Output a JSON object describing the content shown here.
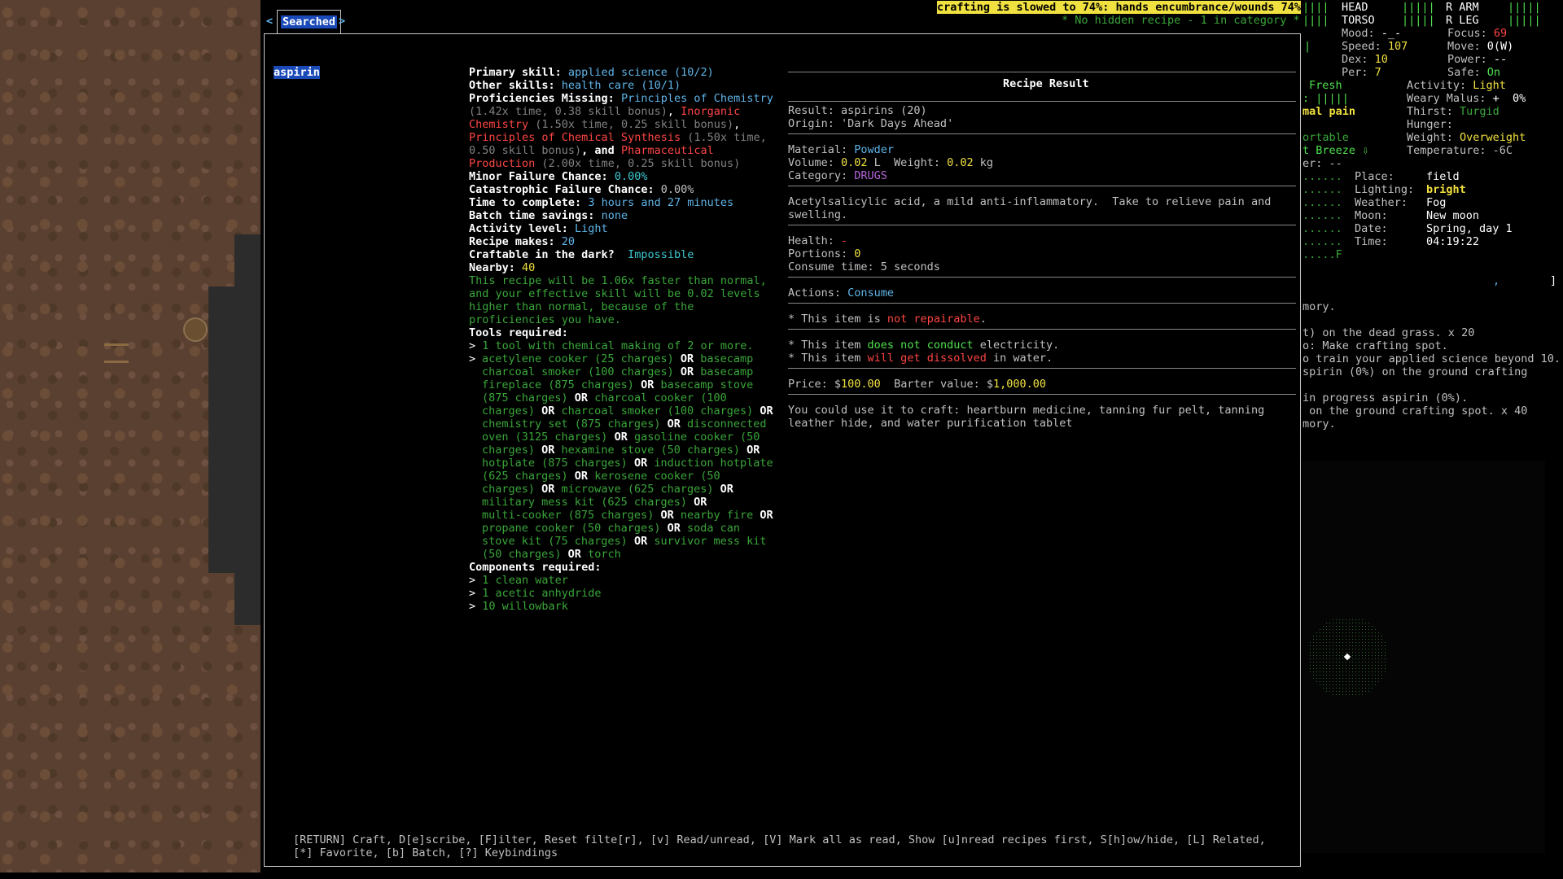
{
  "header": {
    "warning": "crafting is slowed to 74%: hands encumbrance/wounds 74%",
    "hidden_note": "* No hidden recipe - 1 in category *"
  },
  "tabs": {
    "prev_arrow": "<",
    "next_arrow": ">",
    "active_label": "Searched"
  },
  "recipe_list": {
    "selected": "aspirin"
  },
  "details": {
    "primary_skill_label": "Primary skill: ",
    "primary_skill_value": "applied science (10/2)",
    "other_skills_label": "Other skills: ",
    "other_skills_value": "health care (10/1)",
    "prof_missing_label": "Proficiencies Missing: ",
    "prof1": "Principles of Chemistry",
    "prof1_detail": "(1.42x time, 0.38 skill bonus)",
    "prof2a": "Inorganic",
    "prof2b": "Chemistry",
    "prof2_detail": "(1.50x time, 0.25 skill bonus)",
    "prof3": "Principles of Chemical Synthesis",
    "prof3_detail_a": "(1.50x time,",
    "prof3_detail_b": "0.50 skill bonus)",
    "and_text": ", and ",
    "prof4a": "Pharmaceutical",
    "prof4b": "Production",
    "prof4_detail": "(2.00x time, 0.25 skill bonus)",
    "minor_fail_label": "Minor Failure Chance: ",
    "minor_fail_value": "0.00%",
    "cat_fail_label": "Catastrophic Failure Chance: ",
    "cat_fail_value": "0.00%",
    "time_label": "Time to complete: ",
    "time_value": "3 hours and 27 minutes",
    "batch_label": "Batch time savings: ",
    "batch_value": "none",
    "activity_label": "Activity level: ",
    "activity_value": "Light",
    "makes_label": "Recipe makes: ",
    "makes_value": "20",
    "dark_label": "Craftable in the dark?  ",
    "dark_value": "Impossible",
    "nearby_label": "Nearby: ",
    "nearby_value": "40",
    "speed_note": [
      "This recipe will be 1.06x faster than normal,",
      "and your effective skill will be 0.02 levels",
      "higher than normal, because of the",
      "proficiencies you have."
    ],
    "tools_label": "Tools required:",
    "tool1": "1 tool with chemical making of 2 or more.",
    "tool_lines": [
      [
        [
          "acetylene cooker (25 charges)",
          "g"
        ],
        [
          " OR ",
          "w"
        ],
        [
          "basecamp",
          "g"
        ]
      ],
      [
        [
          "charcoal smoker (100 charges)",
          "g"
        ],
        [
          " OR ",
          "w"
        ],
        [
          "basecamp",
          "g"
        ]
      ],
      [
        [
          "fireplace (875 charges)",
          "g"
        ],
        [
          " OR ",
          "w"
        ],
        [
          "basecamp stove",
          "g"
        ]
      ],
      [
        [
          "(875 charges)",
          "g"
        ],
        [
          " OR ",
          "w"
        ],
        [
          "charcoal cooker (100",
          "g"
        ]
      ],
      [
        [
          "charges)",
          "g"
        ],
        [
          " OR ",
          "w"
        ],
        [
          "charcoal smoker (100 charges)",
          "g"
        ],
        [
          " OR",
          "w"
        ]
      ],
      [
        [
          "chemistry set (875 charges)",
          "g"
        ],
        [
          " OR ",
          "w"
        ],
        [
          "disconnected",
          "g"
        ]
      ],
      [
        [
          "oven (3125 charges)",
          "g"
        ],
        [
          " OR ",
          "w"
        ],
        [
          "gasoline cooker (50",
          "g"
        ]
      ],
      [
        [
          "charges)",
          "g"
        ],
        [
          " OR ",
          "w"
        ],
        [
          "hexamine stove (50 charges)",
          "g"
        ],
        [
          " OR",
          "w"
        ]
      ],
      [
        [
          "hotplate (875 charges)",
          "g"
        ],
        [
          " OR ",
          "w"
        ],
        [
          "induction hotplate",
          "g"
        ]
      ],
      [
        [
          "(625 charges)",
          "g"
        ],
        [
          " OR ",
          "w"
        ],
        [
          "kerosene cooker (50",
          "g"
        ]
      ],
      [
        [
          "charges)",
          "g"
        ],
        [
          " OR ",
          "w"
        ],
        [
          "microwave (625 charges)",
          "g"
        ],
        [
          " OR",
          "w"
        ]
      ],
      [
        [
          "military mess kit (625 charges)",
          "g"
        ],
        [
          " OR",
          "w"
        ]
      ],
      [
        [
          "multi-cooker (875 charges)",
          "g"
        ],
        [
          " OR ",
          "w"
        ],
        [
          "nearby fire",
          "g"
        ],
        [
          " OR",
          "w"
        ]
      ],
      [
        [
          "propane cooker (50 charges)",
          "g"
        ],
        [
          " OR ",
          "w"
        ],
        [
          "soda can",
          "g"
        ]
      ],
      [
        [
          "stove kit (75 charges)",
          "g"
        ],
        [
          " OR ",
          "w"
        ],
        [
          "survivor mess kit",
          "g"
        ]
      ],
      [
        [
          "(50 charges)",
          "g"
        ],
        [
          " OR ",
          "w"
        ],
        [
          "torch",
          "g"
        ]
      ]
    ],
    "components_label": "Components required:",
    "components": [
      "1 clean water",
      "1 acetic anhydride",
      "10 willowbark"
    ]
  },
  "result": {
    "title": "Recipe Result",
    "result_line": "Result: aspirins (20)",
    "origin_line": "Origin: 'Dark Days Ahead'",
    "material_label": "Material: ",
    "material_value": "Powder",
    "volume_label": "Volume: ",
    "volume_value": "0.02",
    "volume_unit": " L  Weight: ",
    "weight_value": "0.02",
    "weight_unit": " kg",
    "category_label": "Category: ",
    "category_value": "DRUGS",
    "description": [
      "Acetylsalicylic acid, a mild anti-inflammatory.  Take to relieve pain and",
      "swelling."
    ],
    "health_label": "Health: ",
    "health_value": "-",
    "portions_label": "Portions: ",
    "portions_value": "0",
    "consume_line": "Consume time: 5 seconds",
    "actions_label": "Actions: ",
    "actions_value": "Consume",
    "repair_pre": "* This item is ",
    "repair_val": "not repairable",
    "repair_post": ".",
    "elec_pre": "* This item ",
    "elec_val": "does not conduct",
    "elec_post": " electricity.",
    "water_pre": "* This item ",
    "water_val": "will get dissolved",
    "water_post": " in water.",
    "price_label": "Price: $",
    "price_value": "100.00",
    "barter_label": "  Barter value: $",
    "barter_value": "1,000.00",
    "craft_line1": "You could use it to craft: heartburn medicine, tanning fur pelt, tanning",
    "craft_line2": "leather hide, and water purification tablet"
  },
  "footer": {
    "line1": "[RETURN] Craft, D[e]scribe, [F]ilter, Reset filte[r], [v] Read/unread, [V] Mark all as read, Show [u]nread recipes first, S[h]ow/hide, [L] Related,",
    "line2": "[*] Favorite, [b] Batch, [?] Keybindings"
  },
  "sidebar": {
    "body": {
      "head": "HEAD",
      "head_bar": "|||||",
      "torso": "TORSO",
      "torso_bar": "|||||",
      "r_arm": "R ARM",
      "r_arm_bar": "|||||",
      "r_leg": "R LEG",
      "r_leg_bar": "|||||",
      "left_bar1": "||||",
      "left_bar2": "||||"
    },
    "stats": {
      "mood_label": "Mood: ",
      "mood_value": "-_-",
      "focus_label": "Focus: ",
      "focus_value": "69",
      "speed_label": "Speed: ",
      "speed_value": "107",
      "move_label": "Move: ",
      "move_value": "0(W)",
      "dex_label": "Dex: ",
      "dex_value": "10",
      "power_label": "Power: ",
      "power_value": "--",
      "per_label": "Per: ",
      "per_value": "7",
      "safe_label": "Safe: ",
      "safe_value": "On"
    },
    "needs": {
      "fresh": "Fresh",
      "activity_label": "Activity: ",
      "activity_value": "Light",
      "weary_label": "Weary Malus: ",
      "weary_value": "+  0%",
      "thirst_label": "Thirst: ",
      "thirst_value": "Turgid",
      "hunger_label": "Hunger: ",
      "weight_label": "Weight: ",
      "weight_value": "Overweight",
      "temp_label": "Temperature: ",
      "temp_value": "-6C",
      "bars": ": |||||",
      "pain": "mal pain",
      "comfort": "ortable",
      "wind": "t Breeze ⇩",
      "er": "er: --"
    },
    "env": {
      "place_label": "Place:",
      "place_value": "field",
      "light_label": "Lighting:",
      "light_value": "bright",
      "weather_label": "Weather:",
      "weather_value": "Fog",
      "moon_label": "Moon:",
      "moon_value": "New moon",
      "date_label": "Date:",
      "date_value": "Spring, day 1",
      "time_label": "Time:",
      "time_value": "04:19:22",
      "dots": "......",
      "dots_f": ".....F"
    },
    "messages": [
      "mory.",
      "t) on the dead grass. x 20",
      "o: Make crafting spot.",
      "o train your applied science beyond 10.",
      "spirin (0%) on the ground crafting",
      "",
      "in progress aspirin (0%).",
      " on the ground crafting spot. x 40",
      "mory."
    ],
    "bracket": "]",
    "comma": ","
  }
}
